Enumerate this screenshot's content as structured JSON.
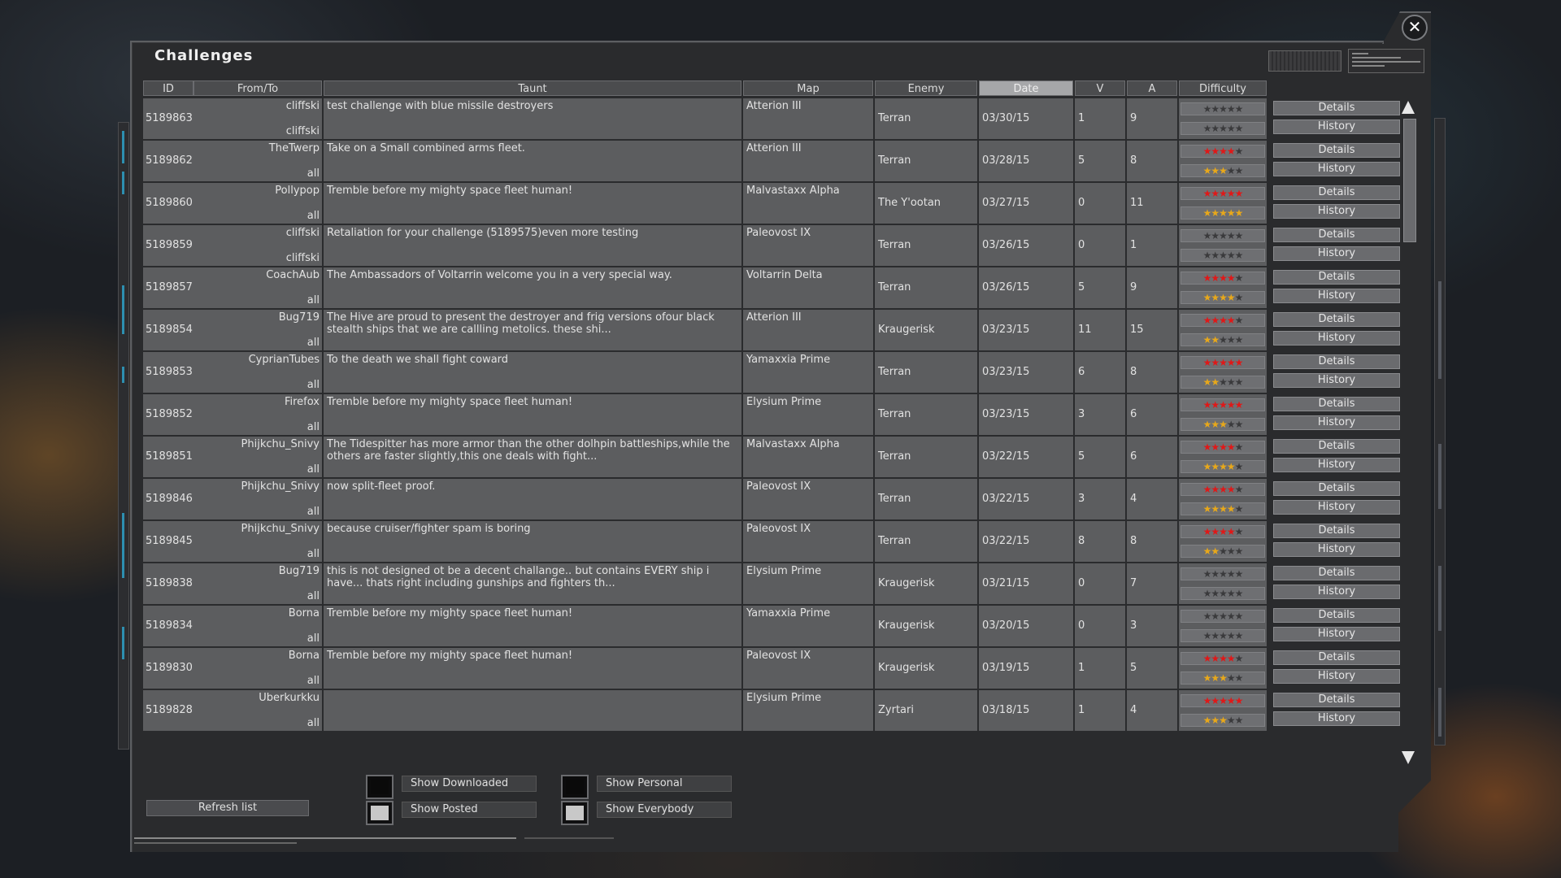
{
  "window": {
    "title": "Challenges",
    "close_glyph": "✕"
  },
  "columns": {
    "id": "ID",
    "from": "From/To",
    "taunt": "Taunt",
    "map": "Map",
    "enemy": "Enemy",
    "date": "Date",
    "v": "V",
    "a": "A",
    "difficulty": "Difficulty",
    "sorted_by": "Date"
  },
  "buttons": {
    "details": "Details",
    "history": "History",
    "refresh": "Refresh list"
  },
  "filters": {
    "show_downloaded": "Show Downloaded",
    "show_posted": "Show Posted",
    "show_personal": "Show Personal",
    "show_everybody": "Show Everybody"
  },
  "star_colors": {
    "filled_top": "#e01818",
    "filled_bottom": "#e8a81a",
    "empty": "#3a3a3c"
  },
  "rows": [
    {
      "id": "5189863",
      "from": "cliffski",
      "to": "cliffski",
      "taunt": "test challenge with blue missile destroyers",
      "map": "Atterion III",
      "enemy": "Terran",
      "date": "03/30/15",
      "v": "1",
      "a": "9",
      "difficulty": 0,
      "rating": 0
    },
    {
      "id": "5189862",
      "from": "TheTwerp",
      "to": "all",
      "taunt": "Take on a Small combined arms fleet.",
      "map": "Atterion III",
      "enemy": "Terran",
      "date": "03/28/15",
      "v": "5",
      "a": "8",
      "difficulty": 4,
      "rating": 3
    },
    {
      "id": "5189860",
      "from": "Pollypop",
      "to": "all",
      "taunt": "Tremble before my mighty space fleet human!",
      "map": "Malvastaxx Alpha",
      "enemy": "The Y'ootan",
      "date": "03/27/15",
      "v": "0",
      "a": "11",
      "difficulty": 5,
      "rating": 5
    },
    {
      "id": "5189859",
      "from": "cliffski",
      "to": "cliffski",
      "taunt": "Retaliation for your challenge (5189575)even more testing",
      "map": "Paleovost IX",
      "enemy": "Terran",
      "date": "03/26/15",
      "v": "0",
      "a": "1",
      "difficulty": 0,
      "rating": 0
    },
    {
      "id": "5189857",
      "from": "CoachAub",
      "to": "all",
      "taunt": "The Ambassadors of Voltarrin welcome you in a very special way.",
      "map": "Voltarrin Delta",
      "enemy": "Terran",
      "date": "03/26/15",
      "v": "5",
      "a": "9",
      "difficulty": 4,
      "rating": 3.5
    },
    {
      "id": "5189854",
      "from": "Bug719",
      "to": "all",
      "taunt": "The Hive are proud to present the destroyer and frig versions ofour black stealth ships that we are callling metolics. these shi...",
      "map": "Atterion III",
      "enemy": "Kraugerisk",
      "date": "03/23/15",
      "v": "11",
      "a": "15",
      "difficulty": 4,
      "rating": 1.5
    },
    {
      "id": "5189853",
      "from": "CyprianTubes",
      "to": "all",
      "taunt": "To the death we shall fight coward",
      "map": "Yamaxxia Prime",
      "enemy": "Terran",
      "date": "03/23/15",
      "v": "6",
      "a": "8",
      "difficulty": 5,
      "rating": 2
    },
    {
      "id": "5189852",
      "from": "Firefox",
      "to": "all",
      "taunt": "Tremble before my mighty space fleet human!",
      "map": "Elysium Prime",
      "enemy": "Terran",
      "date": "03/23/15",
      "v": "3",
      "a": "6",
      "difficulty": 5,
      "rating": 3
    },
    {
      "id": "5189851",
      "from": "Phijkchu_Snivy",
      "to": "all",
      "taunt": "The Tidespitter has more armor than the other dolhpin battleships,while the others are faster slightly,this one deals with fight...",
      "map": "Malvastaxx Alpha",
      "enemy": "Terran",
      "date": "03/22/15",
      "v": "5",
      "a": "6",
      "difficulty": 4,
      "rating": 4
    },
    {
      "id": "5189846",
      "from": "Phijkchu_Snivy",
      "to": "all",
      "taunt": "now split-fleet proof.",
      "map": "Paleovost IX",
      "enemy": "Terran",
      "date": "03/22/15",
      "v": "3",
      "a": "4",
      "difficulty": 4,
      "rating": 3.5
    },
    {
      "id": "5189845",
      "from": "Phijkchu_Snivy",
      "to": "all",
      "taunt": "because cruiser/fighter spam is boring",
      "map": "Paleovost IX",
      "enemy": "Terran",
      "date": "03/22/15",
      "v": "8",
      "a": "8",
      "difficulty": 4,
      "rating": 2
    },
    {
      "id": "5189838",
      "from": "Bug719",
      "to": "all",
      "taunt": "this is not designed ot be a decent challange.. but contains EVERY ship i have... thats right including gunships and fighters th...",
      "map": "Elysium Prime",
      "enemy": "Kraugerisk",
      "date": "03/21/15",
      "v": "0",
      "a": "7",
      "difficulty": 0,
      "rating": 0
    },
    {
      "id": "5189834",
      "from": "Borna",
      "to": "all",
      "taunt": "Tremble before my mighty space fleet human!",
      "map": "Yamaxxia Prime",
      "enemy": "Kraugerisk",
      "date": "03/20/15",
      "v": "0",
      "a": "3",
      "difficulty": 0,
      "rating": 0
    },
    {
      "id": "5189830",
      "from": "Borna",
      "to": "all",
      "taunt": "Tremble before my mighty space fleet human!",
      "map": "Paleovost IX",
      "enemy": "Kraugerisk",
      "date": "03/19/15",
      "v": "1",
      "a": "5",
      "difficulty": 4,
      "rating": 3
    },
    {
      "id": "5189828",
      "from": "Uberkurkku",
      "to": "all",
      "taunt": "",
      "map": "Elysium Prime",
      "enemy": "Zyrtari",
      "date": "03/18/15",
      "v": "1",
      "a": "4",
      "difficulty": 5,
      "rating": 3
    }
  ]
}
